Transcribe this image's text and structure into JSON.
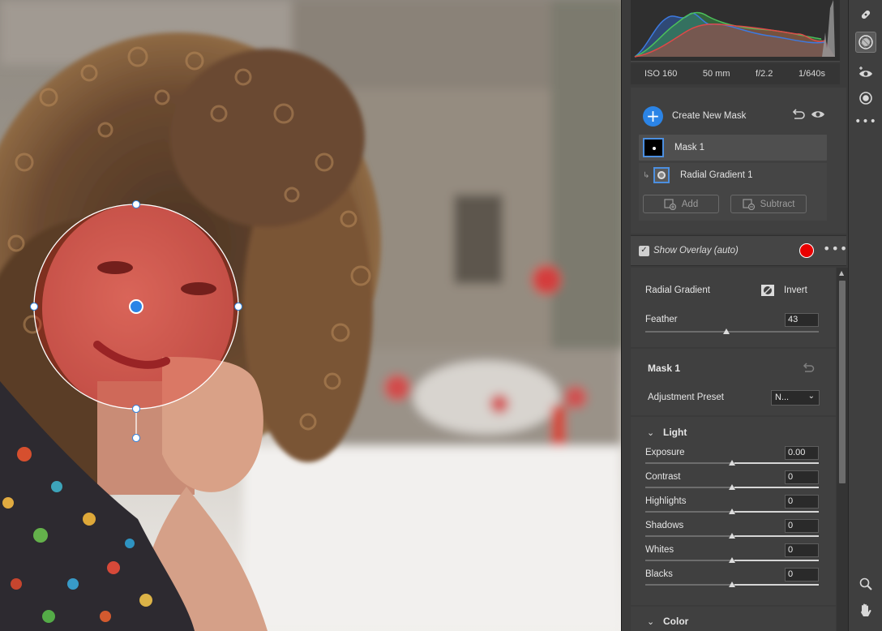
{
  "exif": {
    "iso": "ISO 160",
    "focal": "50 mm",
    "aperture": "f/2.2",
    "shutter": "1/640s"
  },
  "masks": {
    "create_label": "Create New Mask",
    "mask_name": "Mask 1",
    "component_name": "Radial Gradient 1",
    "add_label": "Add",
    "subtract_label": "Subtract"
  },
  "overlay": {
    "label": "Show Overlay (auto)",
    "checked": true,
    "color": "#e90000"
  },
  "radial": {
    "title": "Radial Gradient",
    "invert_label": "Invert",
    "feather_label": "Feather",
    "feather_value": "43",
    "feather_level": 0.43
  },
  "mask_section": {
    "title": "Mask 1",
    "preset_label": "Adjustment Preset",
    "preset_value": "N..."
  },
  "light": {
    "title": "Light",
    "sliders": [
      {
        "label": "Exposure",
        "value": "0.00"
      },
      {
        "label": "Contrast",
        "value": "0"
      },
      {
        "label": "Highlights",
        "value": "0"
      },
      {
        "label": "Shadows",
        "value": "0"
      },
      {
        "label": "Whites",
        "value": "0"
      },
      {
        "label": "Blacks",
        "value": "0"
      }
    ]
  },
  "color_section": {
    "title": "Color"
  },
  "icons": [
    "healing-icon",
    "mask-icon",
    "red-eye-icon",
    "presets-icon",
    "more-icon",
    "zoom-icon",
    "hand-icon"
  ]
}
